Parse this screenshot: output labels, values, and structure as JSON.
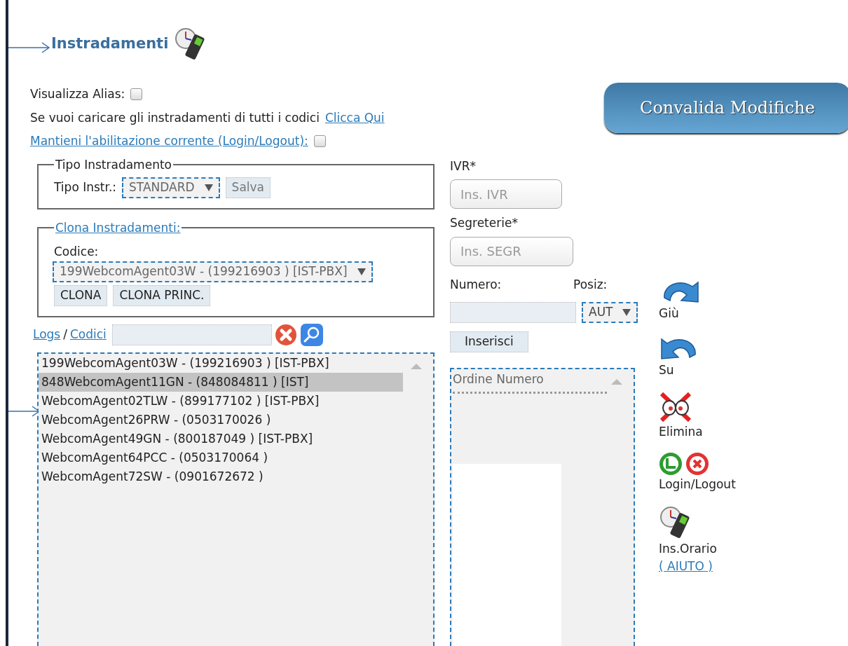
{
  "title": "Instradamenti",
  "visualizza_alias": {
    "label": "Visualizza Alias:",
    "checked": false
  },
  "load_all": {
    "text": "Se vuoi caricare gli instradamenti di tutti i codici",
    "link": "Clicca Qui"
  },
  "keep_enabled": {
    "label": "Mantieni l'abilitazione corrente (Login/Logout):",
    "checked": false
  },
  "validate_button": "Convalida Modifiche",
  "tipo_instradamento": {
    "legend": "Tipo Instradamento",
    "label": "Tipo Instr.:",
    "value": "STANDARD",
    "save_button": "Salva"
  },
  "clona": {
    "legend": "Clona Instradamenti:",
    "label": "Codice:",
    "value": "199WebcomAgent03W - (199216903 ) [IST-PBX]",
    "buttons": [
      "CLONA",
      "CLONA PRINC."
    ]
  },
  "filter": {
    "logs_link": "Logs",
    "separator": "/",
    "codici_link": "Codici"
  },
  "codes": [
    {
      "label": "199WebcomAgent03W - (199216903 ) [IST-PBX]",
      "selected": false
    },
    {
      "label": "848WebcomAgent11GN - (848084811 ) [IST]",
      "selected": true
    },
    {
      "label": "WebcomAgent02TLW - (899177102 ) [IST-PBX]",
      "selected": false
    },
    {
      "label": "WebcomAgent26PRW - (0503170026 )",
      "selected": false
    },
    {
      "label": "WebcomAgent49GN - (800187049 ) [IST-PBX]",
      "selected": false
    },
    {
      "label": "WebcomAgent64PCC - (0503170064 )",
      "selected": false
    },
    {
      "label": "WebcomAgent72SW - (0901672672 )",
      "selected": false
    }
  ],
  "ivr": {
    "label": "IVR*",
    "placeholder": "Ins. IVR"
  },
  "segreterie": {
    "label": "Segreterie*",
    "placeholder": "Ins. SEGR"
  },
  "numero": {
    "label": "Numero:"
  },
  "posiz": {
    "label": "Posiz:",
    "value": "AUT"
  },
  "insert_button": "Inserisci",
  "order_list": {
    "header": "Ordine Numero"
  },
  "actions": [
    {
      "kind": "down",
      "label": "Giù"
    },
    {
      "kind": "up",
      "label": "Su"
    },
    {
      "kind": "delete",
      "label": "Elimina"
    },
    {
      "kind": "login",
      "label": "Login/Logout"
    },
    {
      "kind": "schedule",
      "label": "Ins.Orario",
      "link": "( AIUTO )"
    }
  ]
}
